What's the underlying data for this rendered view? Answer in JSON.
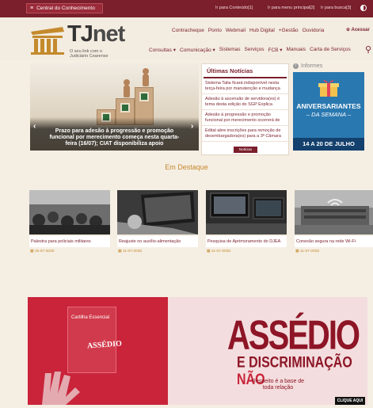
{
  "topbar": {
    "menu_glyph": "≡",
    "central_label": "Central do Conhecimento",
    "skip_links": [
      "Ir para Conteúdo[1]",
      "Ir para menu principal[2]",
      "Ir para busca[3]"
    ],
    "contrast_icon": "contrast-icon",
    "bg_color": "#7a1f2b"
  },
  "header": {
    "logo_tj": "TJ",
    "logo_net": "net",
    "tagline": "O seu link com o Judiciário Cearense",
    "nav_primary": [
      "Contracheque",
      "Ponto",
      "Webmail",
      "Hub Digital",
      "+Gestão",
      "Ouvidoria"
    ],
    "acessar_label": "Acessar",
    "nav_secondary": [
      "Consultas ▾",
      "Comunicação ▾",
      "Sistemas",
      "Serviços",
      "FCB ▾",
      "Manuais",
      "Carta de Serviços"
    ],
    "search_icon": "search-icon"
  },
  "slider": {
    "caption": "Prazo para adesão à progressão e promoção funcional por merecimento começa nesta quarta-feira (16/07); CIAT disponibiliza apoio",
    "prev": "‹",
    "next": "›"
  },
  "news": {
    "title": "Últimas Notícias",
    "items": [
      "Sistema Talia ficará indisponível nesta terça-feira por manutenção e mudança",
      "Adesão à ascensão de servidora(es) é tema desta edição do SGP Explica",
      "Adesão à progressão e promoção funcional por merecimento ocorrerá de",
      "Edital abre inscrições para remoção de desembargadora(es) para a 3ª Câmara"
    ],
    "more_label": "Notícias"
  },
  "informes": {
    "title": "Informes",
    "banner_title": "ANIVERSARIANTES",
    "banner_sub": "– DA SEMANA –",
    "banner_dates": "14 A 20 DE JULHO"
  },
  "destaque": {
    "title": "Em Destaque",
    "cards": [
      {
        "label": "Palestra para policiais militares",
        "date": "15-07-2025"
      },
      {
        "label": "Reajuste no auxílio-alimentação",
        "date": "11-07-2025"
      },
      {
        "label": "Pesquisa de Aprimoramento do DJEA",
        "date": "11-07-2025"
      },
      {
        "label": "Conexão segura na rede Wi-Fi",
        "date": "11-07-2025"
      }
    ]
  },
  "campaign": {
    "cartilha_title": "Cartilha Essencial",
    "cartilha_big": "ASSÉDIO",
    "headline": "ASSÉDIO",
    "subline": "E DISCRIMINAÇÃO",
    "nao": "NÃO",
    "tagline": "Respeito é a base de toda relação",
    "cta": "CLIQUE AQUI"
  }
}
